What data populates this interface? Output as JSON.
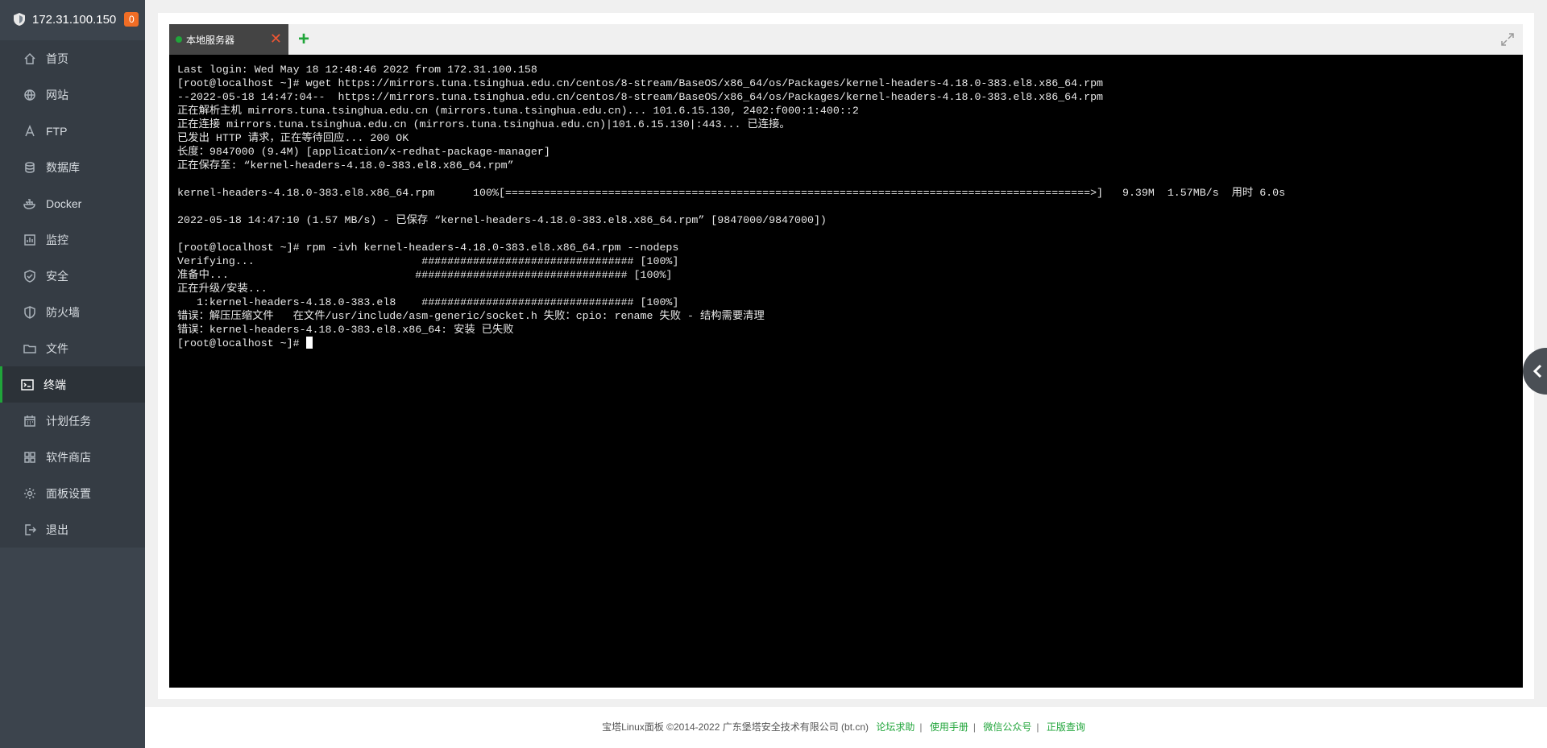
{
  "server": {
    "ip": "172.31.100.150",
    "badge": "0"
  },
  "nav": [
    {
      "label": "首页",
      "icon": "home-icon"
    },
    {
      "label": "网站",
      "icon": "globe-icon"
    },
    {
      "label": "FTP",
      "icon": "ftp-icon"
    },
    {
      "label": "数据库",
      "icon": "database-icon"
    },
    {
      "label": "Docker",
      "icon": "docker-icon"
    },
    {
      "label": "监控",
      "icon": "monitor-icon"
    },
    {
      "label": "安全",
      "icon": "shield-check-icon"
    },
    {
      "label": "防火墙",
      "icon": "shield-icon"
    },
    {
      "label": "文件",
      "icon": "folder-icon"
    },
    {
      "label": "终端",
      "icon": "terminal-icon"
    },
    {
      "label": "计划任务",
      "icon": "calendar-icon"
    },
    {
      "label": "软件商店",
      "icon": "grid-icon"
    },
    {
      "label": "面板设置",
      "icon": "gear-icon"
    },
    {
      "label": "退出",
      "icon": "logout-icon"
    }
  ],
  "active_nav": "终端",
  "tab": {
    "label": "本地服务器",
    "close": "✕",
    "add": "+"
  },
  "terminal": {
    "lines": [
      "Last login: Wed May 18 12:48:46 2022 from 172.31.100.158",
      "[root@localhost ~]# wget https://mirrors.tuna.tsinghua.edu.cn/centos/8-stream/BaseOS/x86_64/os/Packages/kernel-headers-4.18.0-383.el8.x86_64.rpm",
      "--2022-05-18 14:47:04--  https://mirrors.tuna.tsinghua.edu.cn/centos/8-stream/BaseOS/x86_64/os/Packages/kernel-headers-4.18.0-383.el8.x86_64.rpm",
      "正在解析主机 mirrors.tuna.tsinghua.edu.cn (mirrors.tuna.tsinghua.edu.cn)... 101.6.15.130, 2402:f000:1:400::2",
      "正在连接 mirrors.tuna.tsinghua.edu.cn (mirrors.tuna.tsinghua.edu.cn)|101.6.15.130|:443... 已连接。",
      "已发出 HTTP 请求，正在等待回应... 200 OK",
      "长度：9847000 (9.4M) [application/x-redhat-package-manager]",
      "正在保存至: “kernel-headers-4.18.0-383.el8.x86_64.rpm”",
      "",
      "kernel-headers-4.18.0-383.el8.x86_64.rpm      100%[===========================================================================================>]   9.39M  1.57MB/s  用时 6.0s",
      "",
      "2022-05-18 14:47:10 (1.57 MB/s) - 已保存 “kernel-headers-4.18.0-383.el8.x86_64.rpm” [9847000/9847000])",
      "",
      "[root@localhost ~]# rpm -ivh kernel-headers-4.18.0-383.el8.x86_64.rpm --nodeps",
      "Verifying...                          ################################# [100%]",
      "准备中...                             ################################# [100%]",
      "正在升级/安装...",
      "   1:kernel-headers-4.18.0-383.el8    ################################# [100%]",
      "错误：解压压缩文件   在文件/usr/include/asm-generic/socket.h 失败：cpio: rename 失败 - 结构需要清理",
      "错误：kernel-headers-4.18.0-383.el8.x86_64: 安装 已失败",
      "[root@localhost ~]# "
    ]
  },
  "footer": {
    "copyright": "宝塔Linux面板 ©2014-2022 广东堡塔安全技术有限公司 (bt.cn)",
    "links": [
      "论坛求助",
      "使用手册",
      "微信公众号",
      "正版查询"
    ],
    "separator": "|"
  },
  "colors": {
    "accent": "#20a53a",
    "badge": "#f06d25",
    "sidebar": "#3c444d"
  }
}
